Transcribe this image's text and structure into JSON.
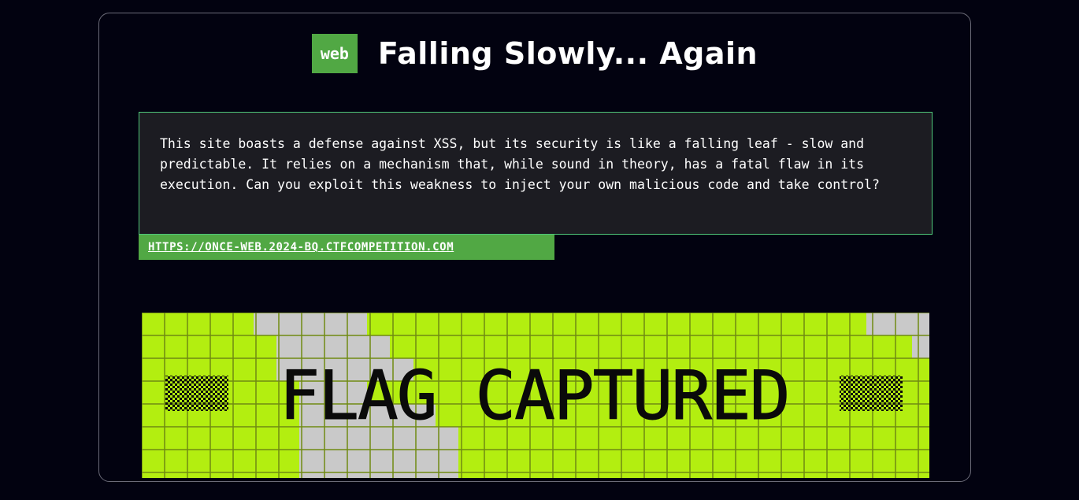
{
  "challenge": {
    "category": "web",
    "title": "Falling Slowly... Again",
    "description": "This site boasts a defense against XSS, but its security is like a falling leaf - slow and predictable. It relies on a mechanism that, while sound in theory, has a fatal flaw in its execution. Can you exploit this weakness to inject your own malicious code and take control?",
    "url": "HTTPS://ONCE-WEB.2024-BQ.CTFCOMPETITION.COM"
  },
  "banner": {
    "text": "FLAG CAPTURED",
    "colors": {
      "lime": "#b3ee10",
      "gray": "#c9c9c9",
      "grid": "#6f8a12",
      "text": "#0a0a0a"
    }
  },
  "colors": {
    "background": "#020210",
    "accent_green": "#51a844",
    "panel": "#1c1c22",
    "panel_border": "#4fc87a"
  }
}
